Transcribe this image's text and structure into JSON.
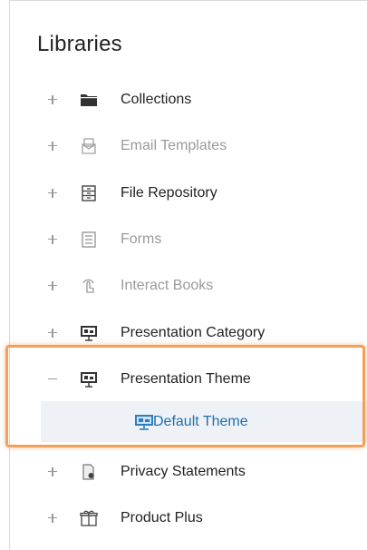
{
  "panel": {
    "title": "Libraries"
  },
  "items": [
    {
      "label": "Collections",
      "icon": "folder-icon",
      "expanded": false,
      "disabled": false
    },
    {
      "label": "Email Templates",
      "icon": "email-template-icon",
      "expanded": false,
      "disabled": true
    },
    {
      "label": "File Repository",
      "icon": "file-cabinet-icon",
      "expanded": false,
      "disabled": false
    },
    {
      "label": "Forms",
      "icon": "form-icon",
      "expanded": false,
      "disabled": true
    },
    {
      "label": "Interact Books",
      "icon": "interact-book-icon",
      "expanded": false,
      "disabled": true
    },
    {
      "label": "Presentation Category",
      "icon": "presentation-icon",
      "expanded": false,
      "disabled": false
    },
    {
      "label": "Presentation Theme",
      "icon": "presentation-icon",
      "expanded": true,
      "disabled": false,
      "children": [
        {
          "label": "Default Theme",
          "icon": "presentation-icon",
          "selected": true
        }
      ]
    },
    {
      "label": "Privacy Statements",
      "icon": "privacy-document-icon",
      "expanded": false,
      "disabled": false
    },
    {
      "label": "Product Plus",
      "icon": "product-box-icon",
      "expanded": false,
      "disabled": false
    }
  ],
  "colors": {
    "highlight_border": "#f5a05a",
    "selected_text": "#1e6fb0",
    "selected_bg": "#eef2f6",
    "icon_blue": "#2d7fc1"
  }
}
